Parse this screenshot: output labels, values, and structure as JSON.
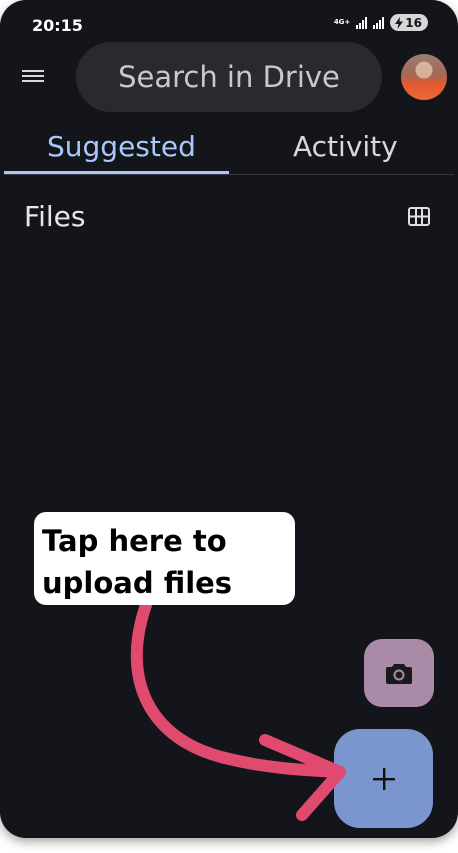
{
  "status_bar": {
    "time": "20:15",
    "network_type": "4G+",
    "battery_level": "16"
  },
  "header": {
    "menu_icon": "hamburger-menu-icon",
    "search_label": "Search in Drive",
    "avatar_icon": "user-avatar"
  },
  "tabs": [
    {
      "label": "Suggested",
      "selected": true
    },
    {
      "label": "Activity",
      "selected": false
    }
  ],
  "main": {
    "section_title": "Files",
    "view_toggle_icon": "grid-view-icon"
  },
  "callout": {
    "line1": "Tap here to",
    "line2": "upload files"
  },
  "fabs": {
    "camera_icon": "camera-icon",
    "new_icon": "plus-icon"
  },
  "colors": {
    "background": "#14151a",
    "accent": "#a8c7fa",
    "search_bg": "#282a30",
    "camera_fab": "#a98aa7",
    "new_fab": "#7b95cf",
    "arrow": "#e04a6e"
  }
}
